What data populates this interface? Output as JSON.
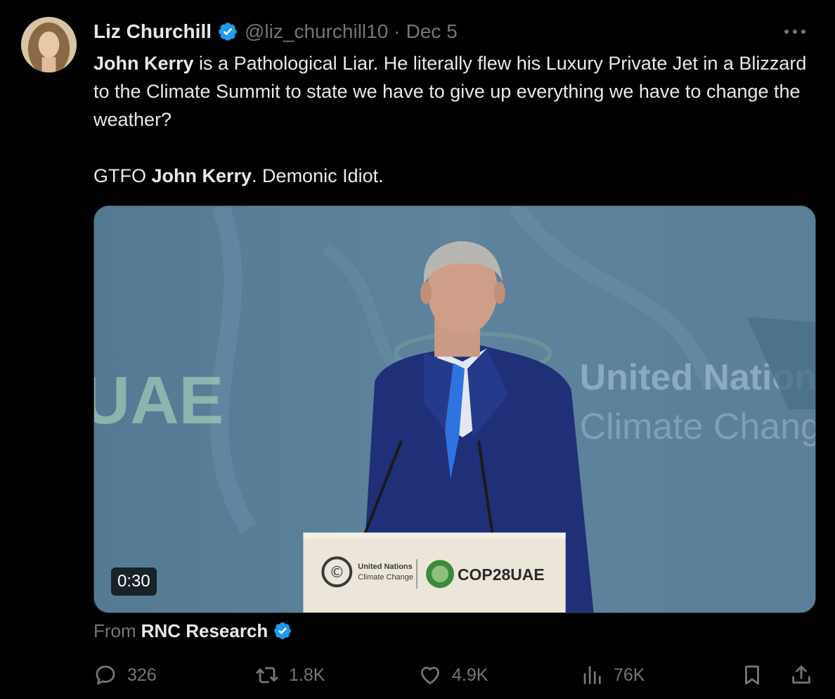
{
  "post": {
    "author": {
      "display_name": "Liz Churchill",
      "handle": "@liz_churchill10",
      "separator": "·",
      "date": "Dec 5",
      "verified_color": "#1d9bf0"
    },
    "text": {
      "p1_bold": "John Kerry",
      "p1_rest": " is a Pathological Liar. He literally flew his Luxury Private Jet in a Blizzard to the Climate Summit to state we have to give up everything we have to change the weather?",
      "p2_pre": "GTFO ",
      "p2_bold": "John Kerry",
      "p2_post": ". Demonic Idiot."
    },
    "media": {
      "duration": "0:30",
      "backdrop_left": "UAE",
      "backdrop_right_line1": "United Nations",
      "backdrop_right_line2": "Climate Change",
      "podium_un_line1": "United Nations",
      "podium_un_line2": "Climate Change",
      "podium_cop": "COP28UAE"
    },
    "source": {
      "prefix": "From",
      "name": "RNC Research"
    },
    "actions": {
      "replies": "326",
      "reposts": "1.8K",
      "likes": "4.9K",
      "views": "76K"
    }
  },
  "colors": {
    "background": "#000000",
    "text_primary": "#e7e9ea",
    "text_secondary": "#71767b",
    "accent": "#1d9bf0"
  },
  "icons": {
    "more": "more-icon",
    "reply": "reply-icon",
    "repost": "repost-icon",
    "like": "heart-icon",
    "views": "views-icon",
    "bookmark": "bookmark-icon",
    "share": "share-icon"
  }
}
